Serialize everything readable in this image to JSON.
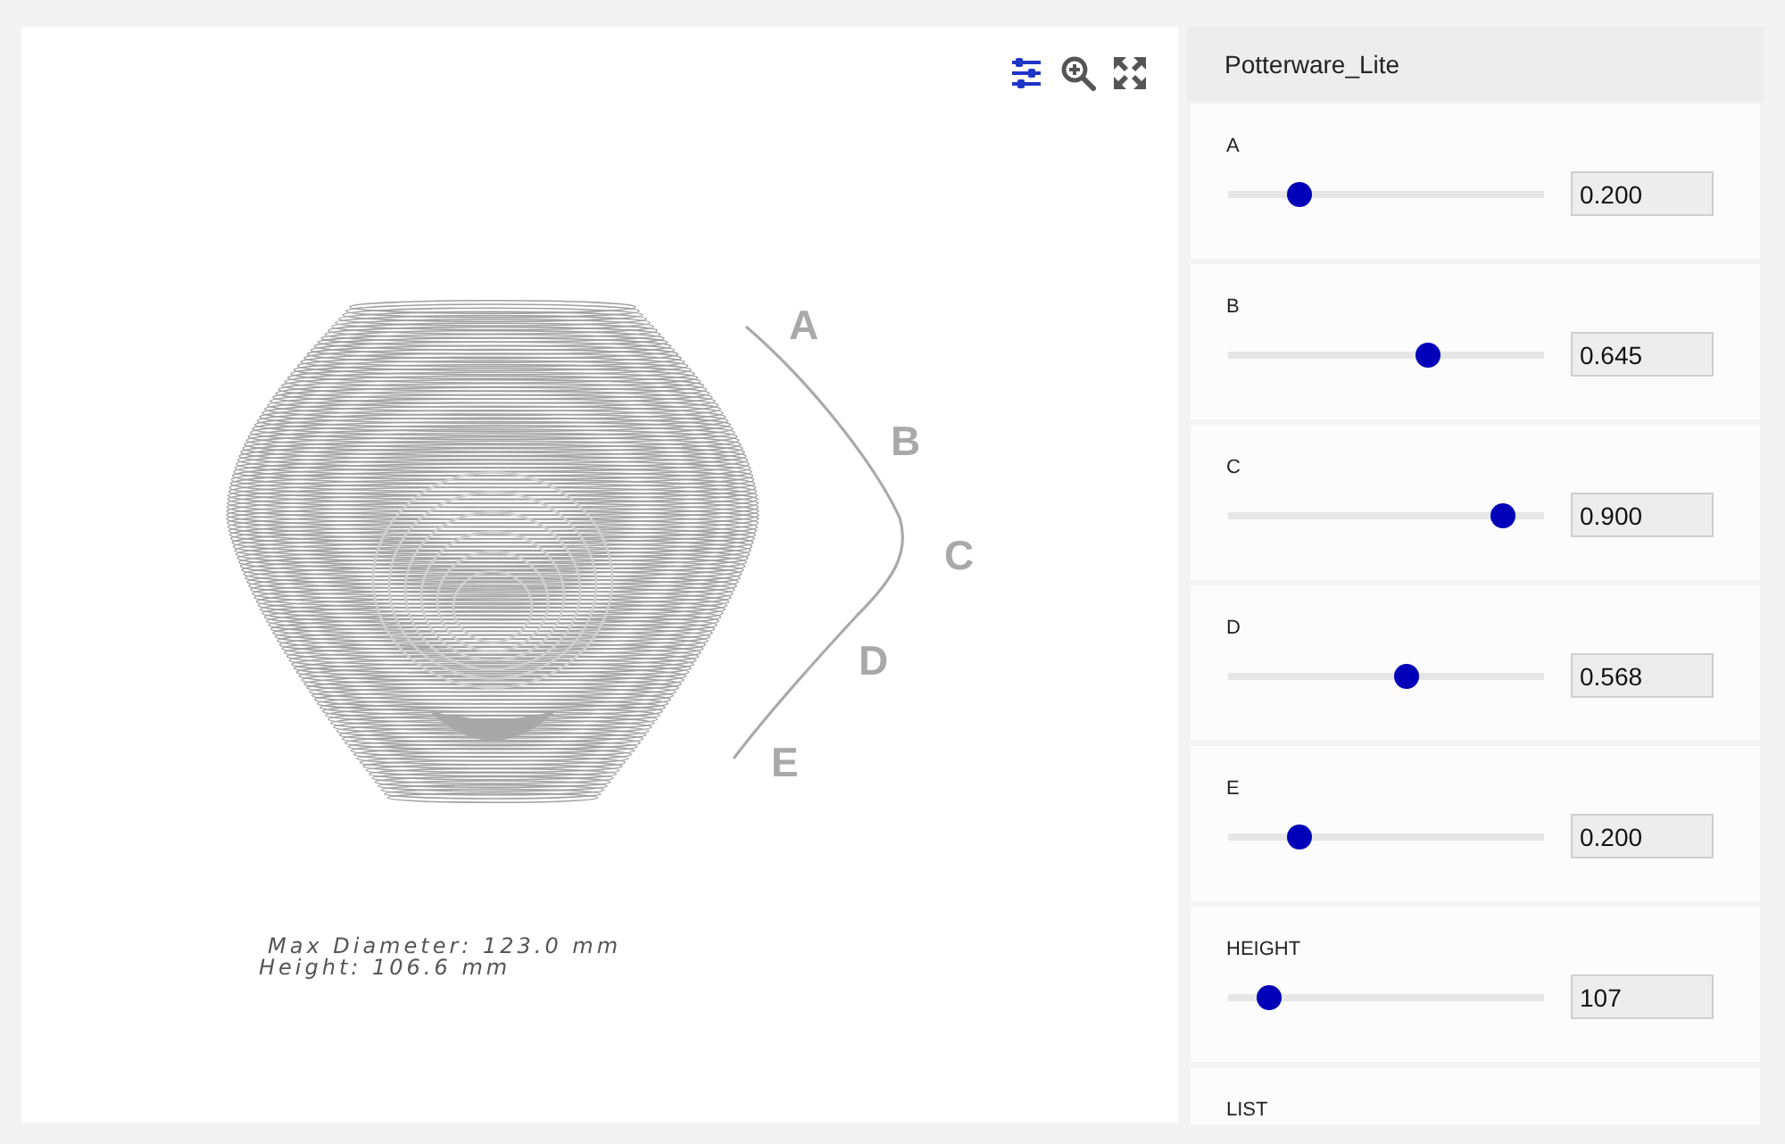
{
  "toolbar": [
    {
      "kind": "sliders",
      "selected": true
    },
    {
      "kind": "zoom_in",
      "selected": false
    },
    {
      "kind": "fullscreen",
      "selected": false
    }
  ],
  "viewer": {
    "profile_labels": [
      "A",
      "B",
      "C",
      "D",
      "E"
    ],
    "stats": [
      "Max Diameter: 123.0 mm",
      "Height: 106.6 mm"
    ]
  },
  "panel": {
    "title": "Potterware_Lite",
    "parameters": [
      {
        "kind": "slider",
        "label": "A",
        "level": 0.2,
        "value": "0.200"
      },
      {
        "kind": "slider",
        "label": "B",
        "level": 0.645,
        "value": "0.645"
      },
      {
        "kind": "slider",
        "label": "C",
        "level": 0.9,
        "value": "0.900"
      },
      {
        "kind": "slider",
        "label": "D",
        "level": 0.568,
        "value": "0.568"
      },
      {
        "kind": "slider",
        "label": "E",
        "level": 0.2,
        "value": "0.200"
      },
      {
        "kind": "slider",
        "label": "HEIGHT",
        "level": 0.1,
        "value": "107"
      },
      {
        "kind": "list",
        "label": "LIST"
      }
    ]
  }
}
